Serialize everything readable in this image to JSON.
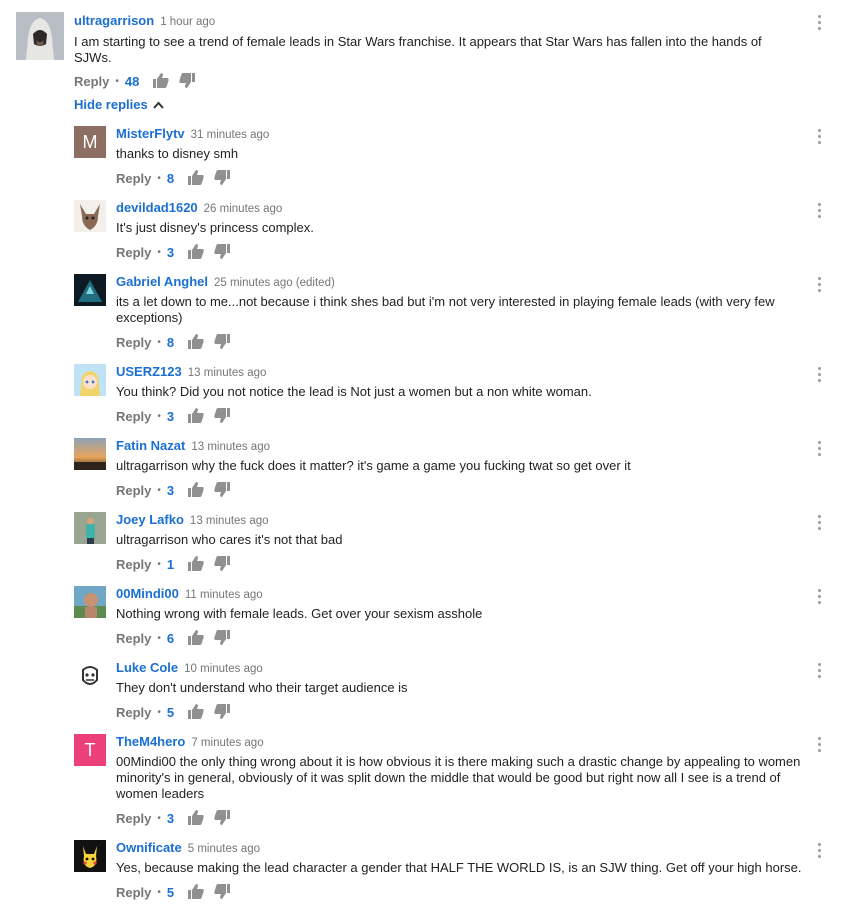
{
  "top": {
    "author": "ultragarrison",
    "time": "1 hour ago",
    "text": "I am starting to see a trend of female leads in Star Wars franchise. It appears that Star Wars has fallen into the hands of SJWs.",
    "reply_label": "Reply",
    "likes": "48"
  },
  "hide_replies_label": "Hide replies",
  "replies": [
    {
      "author": "MisterFlytv",
      "time": "31 minutes ago",
      "text": "thanks to disney smh",
      "reply_label": "Reply",
      "likes": "8",
      "avatar_letter": "M",
      "avatar_color": "#8d6e63"
    },
    {
      "author": "devildad1620",
      "time": "26 minutes ago",
      "text": "It's just disney's princess complex.",
      "reply_label": "Reply",
      "likes": "3"
    },
    {
      "author": "Gabriel Anghel",
      "time": "25 minutes ago (edited)",
      "text": "its a let down to me...not because i think shes bad but i'm not very interested in playing female leads (with very few exceptions)",
      "reply_label": "Reply",
      "likes": "8"
    },
    {
      "author": "USERZ123",
      "time": "13 minutes ago",
      "text": "You think? Did you not notice the lead is Not just a women but a non white woman.",
      "reply_label": "Reply",
      "likes": "3"
    },
    {
      "author": "Fatin Nazat",
      "time": "13 minutes ago",
      "text": "ultragarrison why the fuck does it matter? it's game a game you fucking twat so get over it",
      "reply_label": "Reply",
      "likes": "3"
    },
    {
      "author": "Joey Lafko",
      "time": "13 minutes ago",
      "text": "ultragarrison who cares it's not that bad",
      "reply_label": "Reply",
      "likes": "1"
    },
    {
      "author": "00Mindi00",
      "time": "11 minutes ago",
      "text": "Nothing wrong with female leads. Get over your sexism asshole",
      "reply_label": "Reply",
      "likes": "6"
    },
    {
      "author": "Luke Cole",
      "time": "10 minutes ago",
      "text": "They don't understand who their target audience is",
      "reply_label": "Reply",
      "likes": "5"
    },
    {
      "author": "TheM4hero",
      "time": "7 minutes ago",
      "text": "00Mindi00 the only thing wrong about it is how obvious it is there making such a drastic change by appealing to women minority's in general, obviously of it was split down the middle that would be good but right now all I see is a trend of women leaders",
      "reply_label": "Reply",
      "likes": "3",
      "avatar_letter": "T",
      "avatar_color": "#ec407a"
    },
    {
      "author": "Ownificate",
      "time": "5 minutes ago",
      "text": "Yes, because making the lead character a gender that HALF THE WORLD IS, is an SJW thing. Get off your high horse.",
      "reply_label": "Reply",
      "likes": "5"
    }
  ],
  "colors": {
    "link": "#1b6fd1",
    "meta": "#767676",
    "text": "#222222"
  }
}
